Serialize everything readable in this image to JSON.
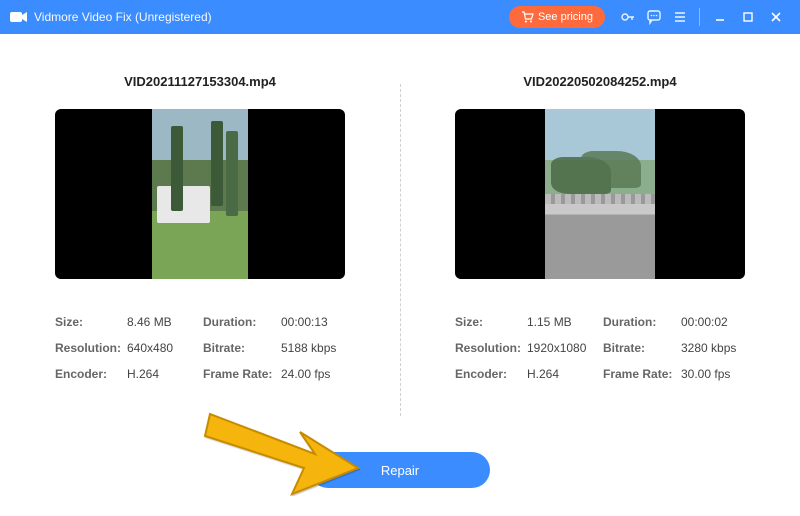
{
  "titlebar": {
    "title": "Vidmore Video Fix (Unregistered)",
    "pricing_label": "See pricing"
  },
  "left": {
    "filename": "VID20211127153304.mp4",
    "size_label": "Size:",
    "size_value": "8.46 MB",
    "duration_label": "Duration:",
    "duration_value": "00:00:13",
    "resolution_label": "Resolution:",
    "resolution_value": "640x480",
    "bitrate_label": "Bitrate:",
    "bitrate_value": "5188 kbps",
    "encoder_label": "Encoder:",
    "encoder_value": "H.264",
    "framerate_label": "Frame Rate:",
    "framerate_value": "24.00 fps"
  },
  "right": {
    "filename": "VID20220502084252.mp4",
    "size_label": "Size:",
    "size_value": "1.15 MB",
    "duration_label": "Duration:",
    "duration_value": "00:00:02",
    "resolution_label": "Resolution:",
    "resolution_value": "1920x1080",
    "bitrate_label": "Bitrate:",
    "bitrate_value": "3280 kbps",
    "encoder_label": "Encoder:",
    "encoder_value": "H.264",
    "framerate_label": "Frame Rate:",
    "framerate_value": "30.00 fps"
  },
  "actions": {
    "repair_label": "Repair"
  }
}
